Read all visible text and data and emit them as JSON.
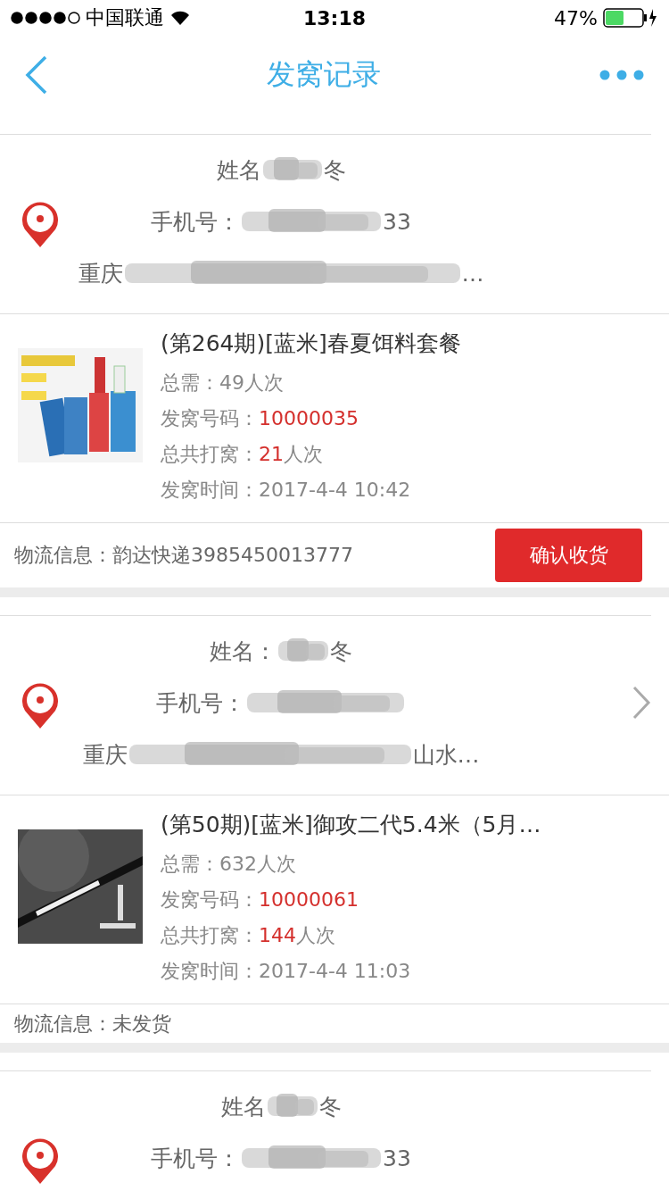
{
  "status_bar": {
    "carrier": "中国联通",
    "time": "13:18",
    "battery": "47%"
  },
  "nav": {
    "title": "发窝记录"
  },
  "orders": [
    {
      "address": {
        "name_label": "姓名",
        "name_tail": "冬",
        "phone_label": "手机号：",
        "phone_tail": "33",
        "addr_head": "重庆",
        "addr_tail": "…",
        "has_arrow": false
      },
      "product": {
        "title": "(第264期)[蓝米]春夏饵料套餐",
        "lines": [
          {
            "label": "总需：",
            "value": "49人次",
            "highlight": false
          },
          {
            "label": "发窝号码：",
            "value": "10000035",
            "highlight": true
          },
          {
            "label": "总共打窝：",
            "value": "21",
            "suffix": "人次",
            "highlight": true
          },
          {
            "label": "发窝时间：",
            "value": "2017-4-4 10:42",
            "highlight": false
          }
        ]
      },
      "logistics": {
        "text": "物流信息：韵达快递3985450013777",
        "button": "确认收货"
      }
    },
    {
      "address": {
        "name_label": "姓名：",
        "name_tail": "冬",
        "phone_label": "手机号：",
        "addr_head": "重庆",
        "addr_tail": "山水…",
        "has_arrow": true
      },
      "product": {
        "title": "(第50期)[蓝米]御攻二代5.4米（5月…",
        "lines": [
          {
            "label": "总需：",
            "value": "632人次",
            "highlight": false
          },
          {
            "label": "发窝号码：",
            "value": "10000061",
            "highlight": true
          },
          {
            "label": "总共打窝：",
            "value": "144",
            "suffix": "人次",
            "highlight": true
          },
          {
            "label": "发窝时间：",
            "value": "2017-4-4 11:03",
            "highlight": false
          }
        ]
      },
      "logistics": {
        "text": "物流信息：未发货"
      }
    },
    {
      "address": {
        "name_label": "姓名",
        "name_tail": "冬",
        "phone_label": "手机号：",
        "phone_tail": "33",
        "has_arrow": false
      }
    }
  ]
}
